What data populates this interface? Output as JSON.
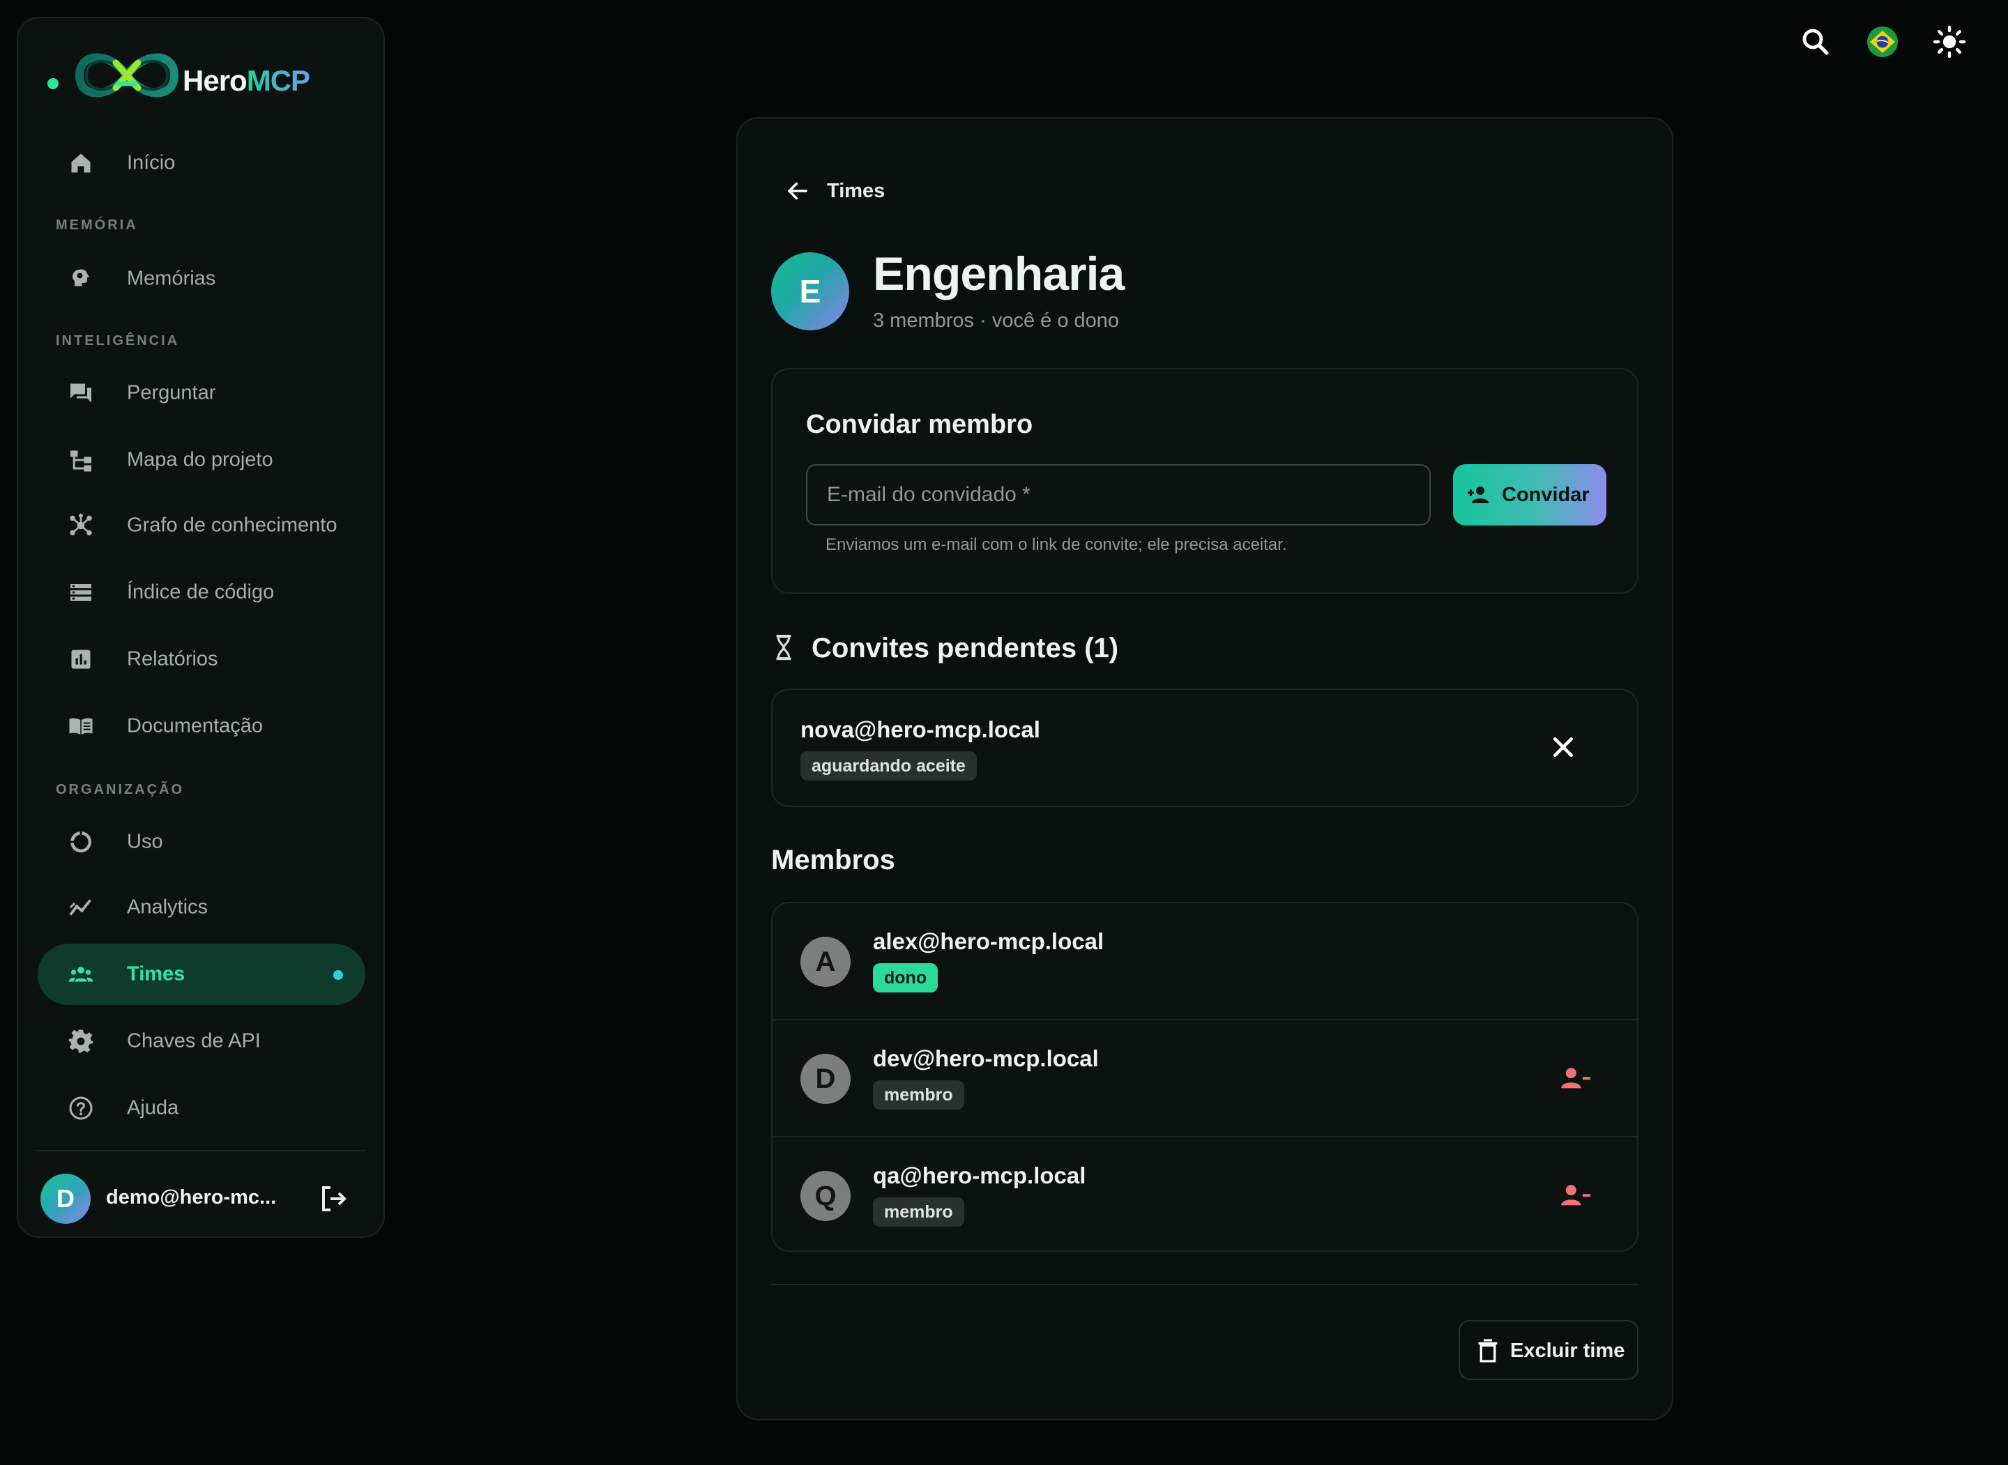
{
  "brand": {
    "name_prefix": "Hero",
    "name_suffix": "MCP"
  },
  "sidebar": {
    "items": [
      {
        "label": "Início",
        "icon": "home-icon"
      },
      {
        "label": "Memórias",
        "icon": "brain-icon"
      },
      {
        "label": "Perguntar",
        "icon": "chat-icon"
      },
      {
        "label": "Mapa do projeto",
        "icon": "tree-icon"
      },
      {
        "label": "Grafo de conhecimento",
        "icon": "graph-icon"
      },
      {
        "label": "Índice de código",
        "icon": "list-icon"
      },
      {
        "label": "Relatórios",
        "icon": "bar-chart-icon"
      },
      {
        "label": "Documentação",
        "icon": "book-icon"
      },
      {
        "label": "Uso",
        "icon": "donut-icon"
      },
      {
        "label": "Analytics",
        "icon": "trend-icon"
      },
      {
        "label": "Times",
        "icon": "group-icon",
        "active": true
      },
      {
        "label": "Chaves de API",
        "icon": "gear-icon"
      },
      {
        "label": "Ajuda",
        "icon": "help-icon"
      }
    ],
    "sections": {
      "memory": "MEMÓRIA",
      "intelligence": "INTELIGÊNCIA",
      "organization": "ORGANIZAÇÃO"
    },
    "user": {
      "initial": "D",
      "email": "demo@hero-mc..."
    }
  },
  "topbar": {
    "icons": [
      "search-icon",
      "brazil-flag-icon",
      "sun-icon"
    ]
  },
  "team": {
    "back_label": "Times",
    "initial": "E",
    "name": "Engenharia",
    "subtitle": "3 membros · você é o dono"
  },
  "invite": {
    "title": "Convidar membro",
    "placeholder": "E-mail do convidado *",
    "button_label": "Convidar",
    "hint": "Enviamos um e-mail com o link de convite; ele precisa aceitar."
  },
  "pending": {
    "title": "Convites pendentes (1)",
    "items": [
      {
        "email": "nova@hero-mcp.local",
        "status": "aguardando aceite"
      }
    ]
  },
  "members": {
    "title": "Membros",
    "items": [
      {
        "initial": "A",
        "email": "alex@hero-mcp.local",
        "role": "dono"
      },
      {
        "initial": "D",
        "email": "dev@hero-mcp.local",
        "role": "membro"
      },
      {
        "initial": "Q",
        "email": "qa@hero-mcp.local",
        "role": "membro"
      }
    ]
  },
  "actions": {
    "delete_label": "Excluir time"
  },
  "colors": {
    "background": "#040807",
    "accent": "#2ee6a0",
    "danger": "#f07474",
    "active_nav": "#0f3b2c"
  }
}
